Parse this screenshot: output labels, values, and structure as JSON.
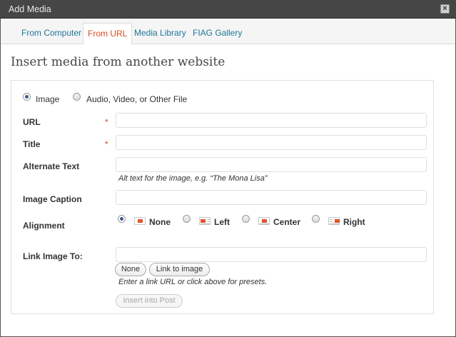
{
  "dialog": {
    "title": "Add Media",
    "close_glyph": "×"
  },
  "tabs": [
    {
      "label": "From Computer",
      "active": false
    },
    {
      "label": "From URL",
      "active": true
    },
    {
      "label": "Media Library",
      "active": false
    },
    {
      "label": "FIAG Gallery",
      "active": false
    }
  ],
  "heading": "Insert media from another website",
  "media_type": {
    "options": [
      {
        "label": "Image",
        "checked": true
      },
      {
        "label": "Audio, Video, or Other File",
        "checked": false
      }
    ]
  },
  "fields": {
    "url": {
      "label": "URL",
      "required_mark": "*",
      "value": ""
    },
    "title": {
      "label": "Title",
      "required_mark": "*",
      "value": ""
    },
    "alt": {
      "label": "Alternate Text",
      "value": "",
      "help": "Alt text for the image, e.g. “The Mona Lisa”"
    },
    "caption": {
      "label": "Image Caption",
      "value": ""
    },
    "alignment": {
      "label": "Alignment",
      "options": [
        {
          "label": "None",
          "checked": true
        },
        {
          "label": "Left",
          "checked": false
        },
        {
          "label": "Center",
          "checked": false
        },
        {
          "label": "Right",
          "checked": false
        }
      ]
    },
    "link": {
      "label": "Link Image To:",
      "value": "",
      "buttons": {
        "none": "None",
        "link_to_image": "Link to image"
      },
      "help": "Enter a link URL or click above for presets."
    }
  },
  "insert_button": "Insert into Post",
  "colors": {
    "titlebar": "#464646",
    "link": "#21759b",
    "active_tab": "#d54e21",
    "required": "#d54e21"
  },
  "icons": [
    "close-icon",
    "align-none-icon",
    "align-left-icon",
    "align-center-icon",
    "align-right-icon"
  ]
}
